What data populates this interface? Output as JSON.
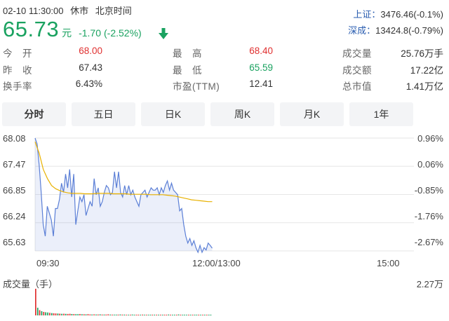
{
  "status": {
    "datetime": "02-10 11:30:00",
    "market_state": "休市",
    "timezone": "北京时间"
  },
  "quote": {
    "price": "65.73",
    "unit": "元",
    "change": "-1.70",
    "change_pct": "(-2.52%)",
    "direction": "down",
    "color": "#1aa260"
  },
  "indices": [
    {
      "name": "上证",
      "value": "3476.46(-0.1%)"
    },
    {
      "name": "深成",
      "value": "13424.8(-0.79%)"
    }
  ],
  "stats": [
    [
      {
        "label": "今　开",
        "value": "68.00",
        "tone": "red"
      },
      {
        "label": "最　高",
        "value": "68.40",
        "tone": "red"
      },
      {
        "label": "成交量",
        "value": "25.76万手",
        "tone": ""
      }
    ],
    [
      {
        "label": "昨　收",
        "value": "67.43",
        "tone": ""
      },
      {
        "label": "最　低",
        "value": "65.59",
        "tone": "green"
      },
      {
        "label": "成交额",
        "value": "17.22亿",
        "tone": ""
      }
    ],
    [
      {
        "label": "换手率",
        "value": "6.43%",
        "tone": ""
      },
      {
        "label": "市盈(TTM)",
        "value": "12.41",
        "tone": ""
      },
      {
        "label": "总市值",
        "value": "1.41万亿",
        "tone": ""
      }
    ]
  ],
  "tabs": [
    {
      "label": "分时",
      "active": true
    },
    {
      "label": "五日",
      "active": false
    },
    {
      "label": "日K",
      "active": false
    },
    {
      "label": "周K",
      "active": false
    },
    {
      "label": "月K",
      "active": false
    },
    {
      "label": "1年",
      "active": false
    }
  ],
  "chart_data": {
    "type": "line",
    "title": "",
    "price_ticks": [
      "68.08",
      "67.47",
      "66.85",
      "66.24",
      "65.63"
    ],
    "pct_ticks": [
      "0.96%",
      "0.06%",
      "-0.85%",
      "-1.76%",
      "-2.67%"
    ],
    "x_ticks": [
      "09:30",
      "12:00/13:00",
      "15:00"
    ],
    "ylim": [
      65.63,
      68.08
    ],
    "total_minutes": 240,
    "grid": true,
    "series": [
      {
        "name": "",
        "color": "#5b7fd6",
        "fill": true,
        "values": [
          68.08,
          67.95,
          67.5,
          66.9,
          66.2,
          65.95,
          66.6,
          66.45,
          66.3,
          65.95,
          66.55,
          66.55,
          66.75,
          67.1,
          66.9,
          67.3,
          67.0,
          67.4,
          66.8,
          67.3,
          66.2,
          66.5,
          66.8,
          66.7,
          66.85,
          66.4,
          66.55,
          66.7,
          66.6,
          67.2,
          66.85,
          67.0,
          66.6,
          66.7,
          66.9,
          67.05,
          67.0,
          66.85,
          66.9,
          67.35,
          67.0,
          67.35,
          66.9,
          66.8,
          67.05,
          66.85,
          67.05,
          66.85,
          66.95,
          66.8,
          66.7,
          66.6,
          66.85,
          66.9,
          66.95,
          66.8,
          66.9,
          67.0,
          66.95,
          66.95,
          67.0,
          66.85,
          67.0,
          66.9,
          67.05,
          67.15,
          66.95,
          67.1,
          66.95,
          66.9,
          66.85,
          66.5,
          66.55,
          66.2,
          65.95,
          65.8,
          65.9,
          65.75,
          65.85,
          65.7,
          65.6,
          65.75,
          65.6,
          65.7,
          65.65,
          65.8,
          65.75,
          65.69
        ]
      },
      {
        "name": "",
        "color": "#e8b100",
        "fill": false,
        "values": [
          68.0,
          67.75,
          67.4,
          67.2,
          67.05,
          66.98,
          66.94,
          66.91,
          66.89,
          66.88,
          66.88,
          66.88,
          66.87,
          66.87,
          66.87,
          66.88,
          66.88,
          66.88,
          66.88,
          66.87,
          66.87,
          66.87,
          66.87,
          66.86,
          66.86,
          66.86,
          66.86,
          66.86,
          66.85,
          66.85,
          66.85,
          66.85,
          66.84,
          66.83,
          66.82,
          66.8,
          66.78,
          66.76,
          66.74,
          66.73,
          66.72,
          66.71,
          66.7,
          66.7
        ]
      }
    ]
  },
  "volume": {
    "title": "成交量（手）",
    "max_label": "2.27万",
    "unit": "手",
    "max": 22700,
    "up_color": "#e03030",
    "down_color": "#1aa260",
    "values": [
      22700,
      6500,
      4500,
      3600,
      3000,
      2700,
      2500,
      2200,
      2000,
      1800,
      1700,
      1600,
      1500,
      1400,
      1450,
      1300,
      1250,
      1400,
      1200,
      1150,
      1100,
      1050,
      1200,
      1000,
      950,
      900,
      1100,
      850,
      800,
      900,
      780,
      760,
      900,
      740,
      720,
      700,
      880,
      690,
      680,
      670,
      660,
      650,
      800,
      640,
      630,
      620,
      610,
      600,
      700,
      590,
      580,
      570,
      560,
      650,
      550,
      540,
      530,
      520,
      600,
      510,
      500,
      490,
      520,
      480,
      470,
      460,
      700,
      450,
      440,
      430,
      420,
      800,
      410,
      400,
      390,
      380,
      600,
      370,
      360,
      350,
      340,
      330,
      320,
      310,
      300,
      290,
      280,
      270
    ],
    "up": [
      1,
      0,
      1,
      0,
      1,
      0,
      0,
      1,
      0,
      1,
      1,
      0,
      1,
      0,
      1,
      0,
      1,
      1,
      0,
      1,
      0,
      0,
      1,
      0,
      1,
      0,
      1,
      1,
      0,
      1,
      0,
      1,
      0,
      1,
      0,
      1,
      1,
      0,
      1,
      0,
      0,
      1,
      0,
      1,
      0,
      1,
      0,
      1,
      0,
      0,
      1,
      1,
      0,
      1,
      0,
      1,
      0,
      0,
      1,
      0,
      1,
      0,
      1,
      0,
      1,
      1,
      0,
      1,
      0,
      0,
      1,
      0,
      1,
      0,
      0,
      0,
      1,
      0,
      1,
      0,
      0,
      1,
      0,
      1,
      0,
      1,
      0,
      0
    ]
  }
}
